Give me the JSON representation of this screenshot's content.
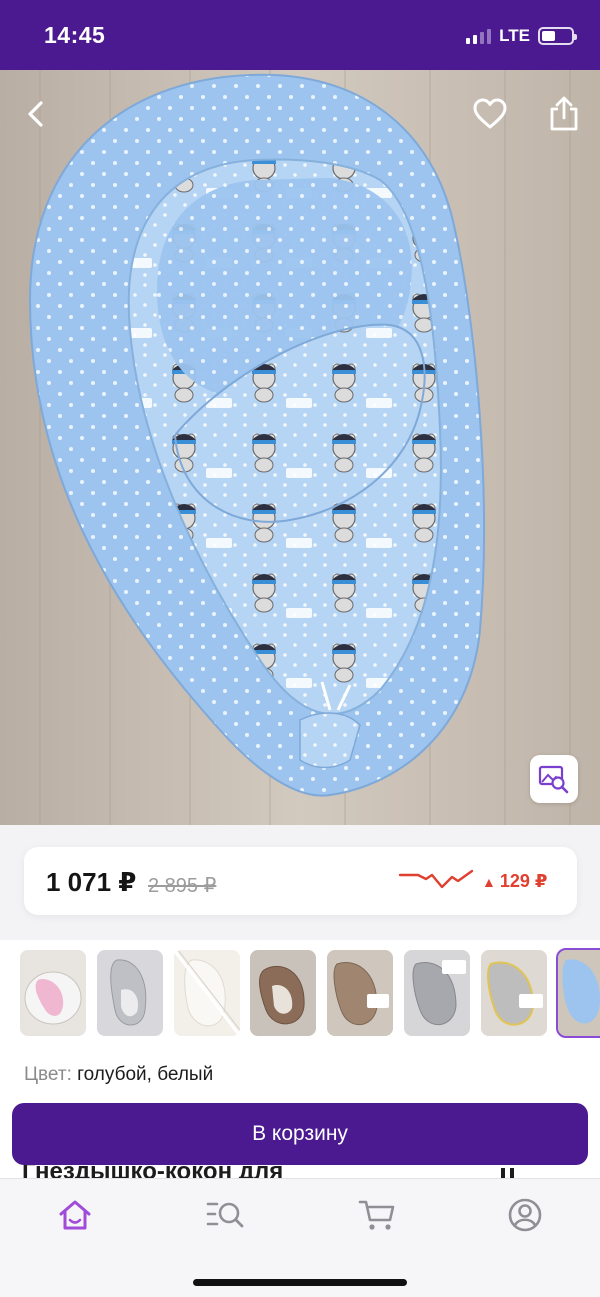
{
  "status_bar": {
    "time": "14:45",
    "network": "LTE",
    "signal_bars": 4,
    "signal_bars_filled": 2,
    "battery_level": 0.45
  },
  "photo": {
    "back_icon": "chevron-left-icon",
    "favorite_icon": "heart-outline-icon",
    "share_icon": "share-icon",
    "visual_search_icon": "image-search-icon"
  },
  "price": {
    "current": "1 071 ₽",
    "old": "2 895 ₽",
    "delta": "129 ₽",
    "delta_icon": "triangle-up-icon",
    "delta_color": "#e0402f"
  },
  "thumbnails": [
    {
      "name": "thumb-1",
      "icon": "product-photo-thumb"
    },
    {
      "name": "thumb-2",
      "icon": "product-photo-thumb"
    },
    {
      "name": "thumb-3",
      "icon": "product-photo-thumb"
    },
    {
      "name": "thumb-4",
      "icon": "product-photo-thumb"
    },
    {
      "name": "thumb-5",
      "icon": "product-photo-thumb"
    },
    {
      "name": "thumb-6",
      "icon": "product-photo-thumb"
    },
    {
      "name": "thumb-7",
      "icon": "product-photo-thumb"
    },
    {
      "name": "thumb-8",
      "icon": "product-photo-thumb",
      "selected": true
    }
  ],
  "color": {
    "label": "Цвет:",
    "value": "голубой, белый"
  },
  "title_peek": "Гнездышко-кокон для",
  "cart_button": "В корзину",
  "bottom_nav": [
    {
      "name": "home",
      "icon": "home-icon",
      "active": true
    },
    {
      "name": "catalog",
      "icon": "catalog-search-icon",
      "active": false
    },
    {
      "name": "cart",
      "icon": "cart-icon",
      "active": false
    },
    {
      "name": "profile",
      "icon": "profile-icon",
      "active": false
    }
  ],
  "colors": {
    "brand": "#4b1a91",
    "accent": "#8a4bd6",
    "price_drop": "#e0402f"
  }
}
